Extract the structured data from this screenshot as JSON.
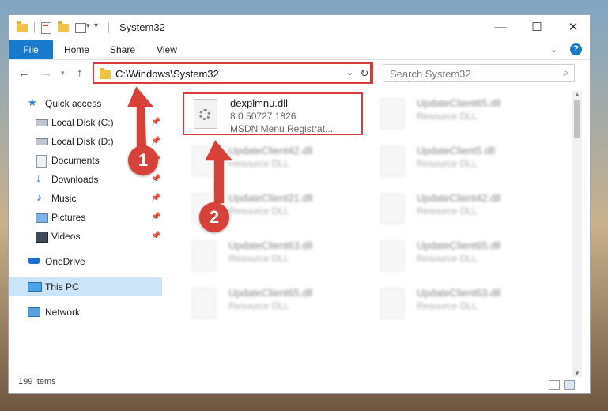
{
  "window": {
    "title": "System32",
    "controls": {
      "minimize": "—",
      "maximize": "☐",
      "close": "✕"
    }
  },
  "ribbon": {
    "tabs": [
      "File",
      "Home",
      "Share",
      "View"
    ]
  },
  "navigation": {
    "back": "←",
    "forward": "→",
    "up": "↑",
    "address": "C:\\Windows\\System32",
    "search_placeholder": "Search System32"
  },
  "sidebar": {
    "items": [
      {
        "label": "Quick access",
        "icon": "star-icon",
        "pinned": false
      },
      {
        "label": "Local Disk (C:)",
        "icon": "drive-icon",
        "pinned": true
      },
      {
        "label": "Local Disk (D:)",
        "icon": "drive-icon",
        "pinned": true
      },
      {
        "label": "Documents",
        "icon": "documents-icon",
        "pinned": true
      },
      {
        "label": "Downloads",
        "icon": "download-icon",
        "pinned": true
      },
      {
        "label": "Music",
        "icon": "music-icon",
        "pinned": true
      },
      {
        "label": "Pictures",
        "icon": "pictures-icon",
        "pinned": true
      },
      {
        "label": "Videos",
        "icon": "videos-icon",
        "pinned": true
      },
      {
        "label": "OneDrive",
        "icon": "cloud-icon",
        "pinned": false
      },
      {
        "label": "This PC",
        "icon": "computer-icon",
        "pinned": false,
        "selected": true
      },
      {
        "label": "Network",
        "icon": "network-icon",
        "pinned": false
      }
    ]
  },
  "files": [
    {
      "name": "dexplmnu.dll",
      "line2": "8.0.50727.1826",
      "line3": "MSDN Menu Registrat...",
      "highlighted": true
    },
    {
      "name": "UpdateClient65.dll",
      "line2": "Resource DLL",
      "line3": ""
    },
    {
      "name": "UpdateClient42.dll",
      "line2": "Resource DLL",
      "line3": ""
    },
    {
      "name": "UpdateClient5.dll",
      "line2": "Resource DLL",
      "line3": ""
    },
    {
      "name": "UpdateClient21.dll",
      "line2": "Resource DLL",
      "line3": ""
    },
    {
      "name": "UpdateClient42.dll",
      "line2": "Resource DLL",
      "line3": ""
    },
    {
      "name": "UpdateClient63.dll",
      "line2": "Resource DLL",
      "line3": ""
    },
    {
      "name": "UpdateClient65.dll",
      "line2": "Resource DLL",
      "line3": ""
    },
    {
      "name": "UpdateClient65.dll",
      "line2": "Resource DLL",
      "line3": ""
    },
    {
      "name": "UpdateClient63.dll",
      "line2": "Resource DLL",
      "line3": ""
    }
  ],
  "status": {
    "item_count": "199 items"
  },
  "callouts": [
    "1",
    "2"
  ],
  "colors": {
    "accent": "#1979ca",
    "highlight": "#d93b3b"
  }
}
